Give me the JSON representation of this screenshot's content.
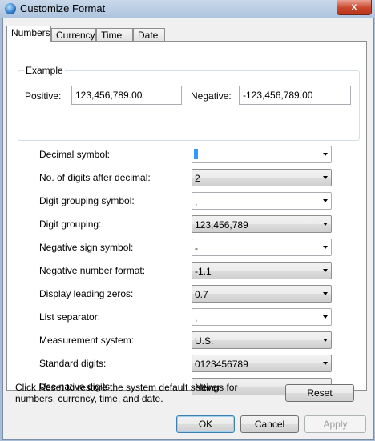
{
  "window": {
    "title": "Customize Format",
    "close_label": "x"
  },
  "tabs": [
    {
      "label": "Numbers",
      "active": true
    },
    {
      "label": "Currency",
      "active": false
    },
    {
      "label": "Time",
      "active": false
    },
    {
      "label": "Date",
      "active": false
    }
  ],
  "example": {
    "group_label": "Example",
    "positive_label": "Positive:",
    "positive_value": "123,456,789.00",
    "negative_label": "Negative:",
    "negative_value": "-123,456,789.00"
  },
  "settings": [
    {
      "label": "Decimal symbol:",
      "value": ".",
      "editable": true
    },
    {
      "label": "No. of digits after decimal:",
      "value": "2",
      "editable": false
    },
    {
      "label": "Digit grouping symbol:",
      "value": ",",
      "editable": true
    },
    {
      "label": "Digit grouping:",
      "value": "123,456,789",
      "editable": false
    },
    {
      "label": "Negative sign symbol:",
      "value": "-",
      "editable": true
    },
    {
      "label": "Negative number format:",
      "value": "-1.1",
      "editable": false
    },
    {
      "label": "Display leading zeros:",
      "value": "0.7",
      "editable": false
    },
    {
      "label": "List separator:",
      "value": ",",
      "editable": true
    },
    {
      "label": "Measurement system:",
      "value": "U.S.",
      "editable": false
    },
    {
      "label": "Standard digits:",
      "value": "0123456789",
      "editable": false
    },
    {
      "label": "Use native digits:",
      "value": "Never",
      "editable": false
    }
  ],
  "reset": {
    "note_line1": "Click Reset to restore the system default settings for",
    "note_line2": "numbers, currency, time, and date.",
    "button_label": "Reset"
  },
  "footer": {
    "ok": "OK",
    "cancel": "Cancel",
    "apply": "Apply"
  }
}
